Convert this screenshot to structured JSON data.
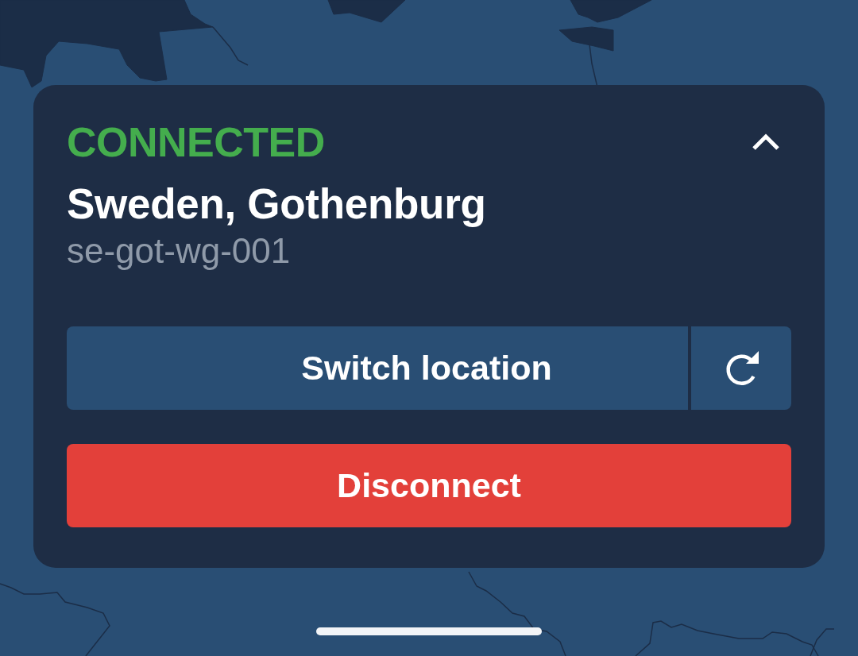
{
  "status": {
    "connected": true,
    "label": "CONNECTED"
  },
  "panel": {
    "expanded": false
  },
  "location": "Sweden, Gothenburg",
  "server": "se-got-wg-001",
  "buttons": [
    {
      "kind": "switch_location",
      "label": "Switch location"
    },
    {
      "kind": "reconnect"
    },
    {
      "kind": "disconnect",
      "label": "Disconnect"
    }
  ]
}
